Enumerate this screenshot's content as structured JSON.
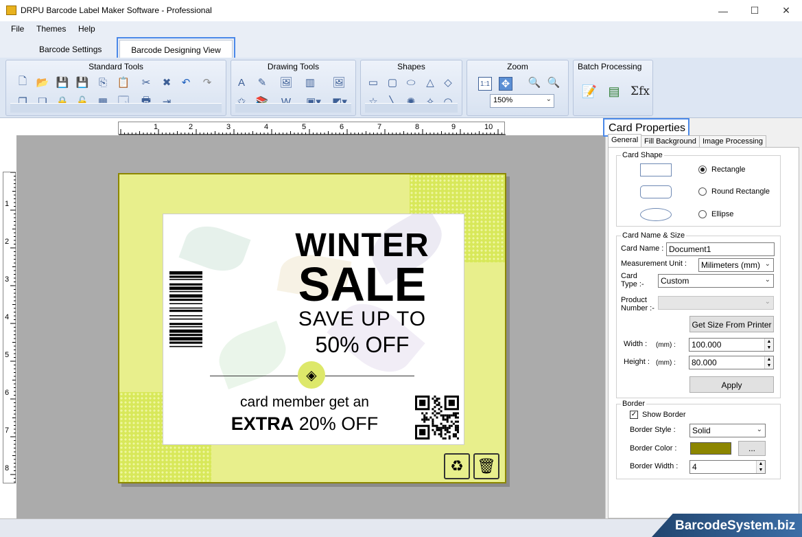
{
  "window": {
    "title": "DRPU Barcode Label Maker Software - Professional",
    "controls": {
      "minimize": "—",
      "maximize": "☐",
      "close": "✕"
    }
  },
  "menu": [
    "File",
    "Themes",
    "Help"
  ],
  "tabs": [
    "Barcode Settings",
    "Barcode Designing View"
  ],
  "ribbon": {
    "standard_tools": "Standard Tools",
    "drawing_tools": "Drawing Tools",
    "shapes": "Shapes",
    "zoom": "Zoom",
    "zoom_value": "150%",
    "zoom_fit": "1:1",
    "batch_processing": "Batch Processing",
    "formula_icon": "Σfx"
  },
  "ruler": {
    "h": [
      "1",
      "2",
      "3",
      "4",
      "5",
      "6",
      "7",
      "8",
      "9",
      "10"
    ],
    "v": [
      "1",
      "2",
      "3",
      "4",
      "5",
      "6",
      "7",
      "8"
    ]
  },
  "card": {
    "headline1": "WINTER",
    "headline2": "SALE",
    "line3": "SAVE UP TO",
    "line4": "50% OFF",
    "line5": "card member get an",
    "line6a": "EXTRA",
    "line6b": "20% OFF"
  },
  "panel": {
    "title": "Card Properties",
    "tabs": [
      "General",
      "Fill Background",
      "Image Processing"
    ],
    "card_shape": {
      "legend": "Card Shape",
      "options": [
        "Rectangle",
        "Round Rectangle",
        "Ellipse"
      ]
    },
    "card_name_size": {
      "legend": "Card  Name & Size",
      "card_name_label": "Card Name :",
      "card_name_value": "Document1",
      "unit_label": "Measurement Unit :",
      "unit_value": "Milimeters (mm)",
      "card_type_label": "Card\nType :-",
      "card_type_value": "Custom",
      "product_number_label": "Product\nNumber :-",
      "get_size_button": "Get Size From Printer",
      "width_label": "Width :",
      "width_unit": "(mm) :",
      "width_value": "100.000",
      "height_label": "Height :",
      "height_unit": "(mm) :",
      "height_value": "80.000",
      "apply_button": "Apply"
    },
    "border": {
      "legend": "Border",
      "show_border": "Show Border",
      "style_label": "Border Style :",
      "style_value": "Solid",
      "color_label": "Border Color :",
      "color_value": "#8c8600",
      "color_button": "...",
      "width_label": "Border Width :",
      "width_value": "4"
    }
  },
  "brand": "BarcodeSystem.biz"
}
